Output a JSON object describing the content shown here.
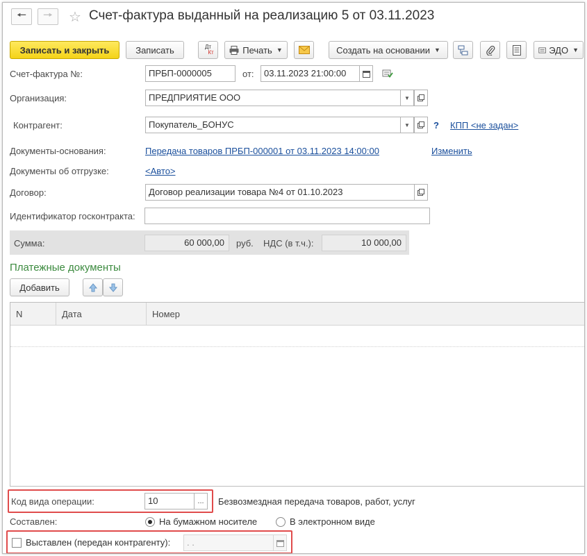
{
  "window": {
    "title": "Счет-фактура выданный на реализацию 5 от 03.11.2023"
  },
  "toolbar": {
    "save_close": "Записать и закрыть",
    "save": "Записать",
    "dtkt_top": "Дт",
    "dtkt_bottom": "Кт",
    "print": "Печать",
    "create_based": "Создать на основании",
    "edo": "ЭДО"
  },
  "form": {
    "invoice_label": "Счет-фактура №:",
    "invoice_number": "ПРБП-0000005",
    "from_label": "от:",
    "date": "03.11.2023 21:00:00",
    "org_label": "Организация:",
    "org_value": "ПРЕДПРИЯТИЕ ООО",
    "counterparty_label": "Контрагент:",
    "counterparty_value": "Покупатель_БОНУС",
    "help_mark": "?",
    "kpp_link": "КПП <не задан>",
    "base_docs_label": "Документы-основания:",
    "base_docs_link": "Передача товаров ПРБП-000001 от 03.11.2023 14:00:00",
    "change_link": "Изменить",
    "shipment_docs_label": "Документы об отгрузке:",
    "shipment_docs_link": "<Авто>",
    "contract_label": "Договор:",
    "contract_value": "Договор реализации товара №4 от 01.10.2023",
    "gov_id_label": "Идентификатор госконтракта:",
    "gov_id_value": "",
    "sum_label": "Сумма:",
    "sum_value": "60 000,00",
    "currency": "руб.",
    "vat_label": "НДС (в т.ч.):",
    "vat_value": "10 000,00"
  },
  "payments": {
    "title": "Платежные документы",
    "add_button": "Добавить",
    "columns": [
      "N",
      "Дата",
      "Номер"
    ]
  },
  "bottom": {
    "op_code_label": "Код вида операции:",
    "op_code_value": "10",
    "op_code_ellipsis": "...",
    "op_code_desc": "Безвозмездная передача товаров, работ, услуг",
    "composed_label": "Составлен:",
    "paper_option": "На бумажном носителе",
    "electronic_option": "В электронном виде",
    "issued_label": "Выставлен (передан контрагенту):",
    "issued_date_placeholder": " .  ."
  },
  "colors": {
    "primary_button": "#f4d318",
    "link": "#1a4f9c",
    "section_title": "#3b8a3e",
    "highlight": "#e04b4b"
  }
}
